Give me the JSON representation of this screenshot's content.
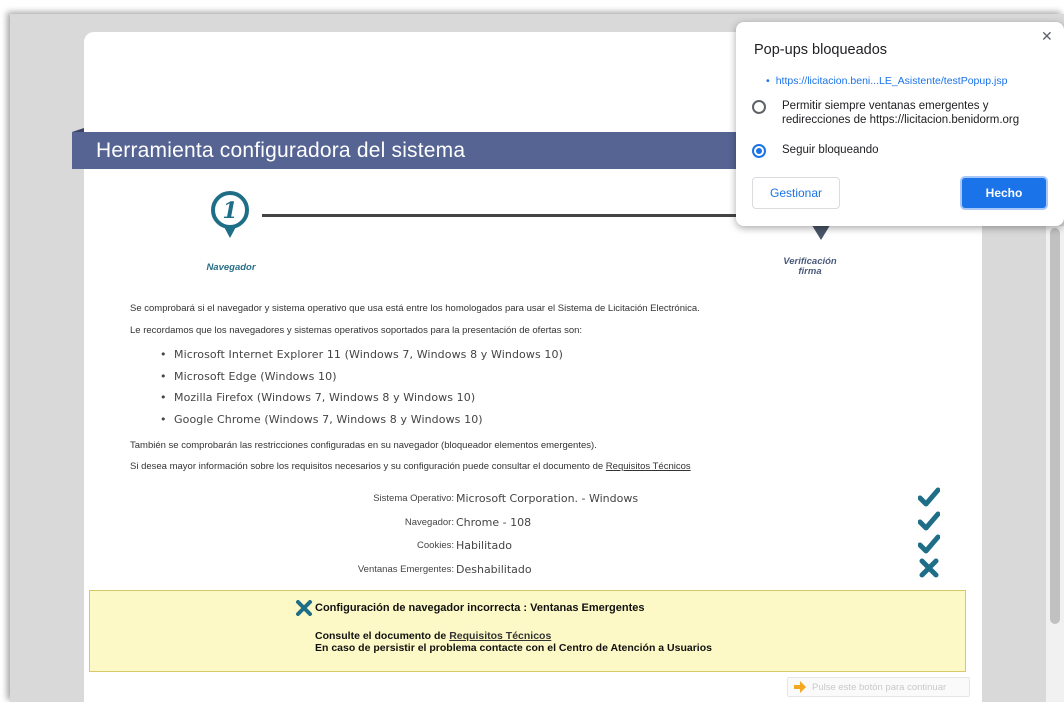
{
  "page": {
    "banner_title": "Herramienta configuradora del sistema",
    "steps": [
      {
        "number": "1",
        "label": "Navegador"
      },
      {
        "label_line1": "Verificación",
        "label_line2": "firma"
      }
    ],
    "intro": "Se comprobará si el navegador y sistema operativo que usa está entre los homologados para usar el Sistema de Licitación Electrónica.",
    "supported_intro": "Le recordamos que los navegadores y sistemas operativos soportados para la presentación de ofertas son:",
    "supported_list": [
      "Microsoft Internet Explorer 11 (Windows 7, Windows 8 y Windows 10)",
      "Microsoft Edge (Windows 10)",
      "Mozilla Firefox (Windows 7, Windows 8 y Windows 10)",
      "Google Chrome (Windows 7, Windows 8 y Windows 10)"
    ],
    "restrictions_text": "También se comprobarán las restricciones configuradas en su navegador (bloqueador elementos emergentes).",
    "more_info_text": "Si desea mayor información sobre los requisitos necesarios y su configuración puede consultar el documento de ",
    "more_info_link": "Requisitos Técnicos",
    "checks": [
      {
        "label": "Sistema Operativo:",
        "value": "Microsoft Corporation. - Windows",
        "status": "ok"
      },
      {
        "label": "Navegador:",
        "value": "Chrome - 108",
        "status": "ok"
      },
      {
        "label": "Cookies:",
        "value": "Habilitado",
        "status": "ok"
      },
      {
        "label": "Ventanas Emergentes:",
        "value": "Deshabilitado",
        "status": "error"
      }
    ],
    "warning": {
      "title": "Configuración de navegador incorrecta : Ventanas Emergentes",
      "line1_prefix": "Consulte el documento de ",
      "line1_link": "Requisitos Técnicos",
      "line2": "En caso de persistir el problema contacte con el Centro de Atención a Usuarios"
    },
    "continue_button": "Pulse este botón para continuar"
  },
  "popup": {
    "title": "Pop-ups bloqueados",
    "url": "https://licitacion.beni...LE_Asistente/testPopup.jsp",
    "option_allow": "Permitir siempre ventanas emergentes y redirecciones de https://licitacion.benidorm.org",
    "option_block": "Seguir bloqueando",
    "selected": "block",
    "manage_button": "Gestionar",
    "done_button": "Hecho"
  },
  "colors": {
    "banner": "#566494",
    "accent_teal": "#1f6e87",
    "warning_bg": "#fdf9c6",
    "chrome_blue": "#1a73e8"
  },
  "icons": [
    "step-1-pin-icon",
    "step-2-pin-icon",
    "check-icon",
    "cross-icon",
    "arrow-right-icon",
    "close-icon"
  ]
}
